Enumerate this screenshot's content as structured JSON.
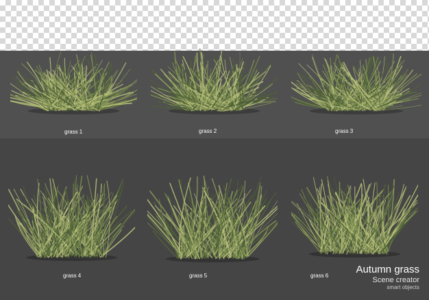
{
  "labels": [
    "grass 1",
    "grass 2",
    "grass 3",
    "grass 4",
    "grass 5",
    "grass 6"
  ],
  "brand": {
    "title": "Autumn grass",
    "subtitle": "Scene creator",
    "small": "smart objects"
  },
  "colors": {
    "checker_light": "#ffffff",
    "checker_dark": "#d8d8d8",
    "panel_top": "#505050",
    "panel_bottom": "#454545",
    "grass_dark": "#4f6236",
    "grass_mid": "#7d8f52",
    "grass_light": "#b7bf7a"
  }
}
